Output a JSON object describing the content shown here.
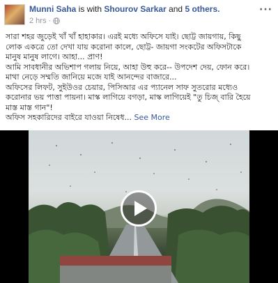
{
  "post": {
    "author": "Munni Saha",
    "with_text": " is with ",
    "tagged": "Shourov Sarkar",
    "and_text": " and ",
    "others": "5 others.",
    "time": "2 hrs",
    "separator": "·",
    "privacy_icon": "globe-icon",
    "more_icon": "ellipsis-icon",
    "more_label": "···",
    "text_lines": [
      "সারা শহর জুড়েই খাঁ খাঁ হাহাকার। এরই মধ্যে অফিসে যাই। ছোট্ট জায়গায়, কিছু",
      "লোক একত্রে তো দেখা যায় করোনা কালে, ছোট্ট- জায়গা সংকটের অফিসটাকে",
      "মানুষ মানুষ লাগে। আহা... প্রাণ!",
      "আমি সাবধানীর অভিশাপ গলায় নিয়ে, আহা উহু করে-- উপদেশ দেয়, ফোন করে।",
      "মাথা নেড়ে সম্মতি জানিয়ে মজে যাই আনন্দের বাজারে...",
      "অফিসের লিফট, সুইউওর চেয়ার, পিসিআর এর প্যানেল সাফ সুতরোর মধ্যেও",
      "করোনার ভয় পাত্তা পায়না। মাস্ক লাগিয়ে বগড়া, মাস্ক লাগিয়েই \"তু চিজ্‌ বারি হৈয়ে",
      "মাস্ত মাস্ত গান\"!"
    ],
    "last_line": "অফিস সহকারিদের বাইরে যাওয়া নিষেধ...",
    "see_more": "See More"
  },
  "video": {
    "play_icon": "play-icon"
  }
}
